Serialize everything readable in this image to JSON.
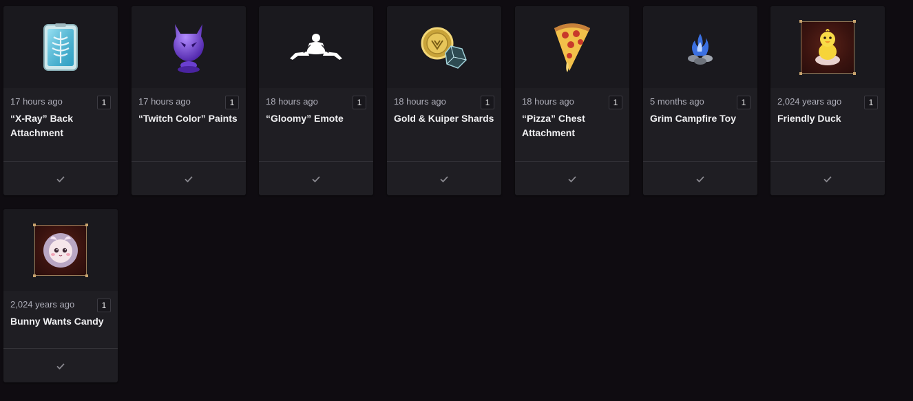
{
  "items": [
    {
      "time": "17 hours ago",
      "qty": "1",
      "name": "“X-Ray” Back Attachment",
      "icon": "xray-back-attachment-icon"
    },
    {
      "time": "17 hours ago",
      "qty": "1",
      "name": "“Twitch Color” Paints",
      "icon": "purple-paint-helmet-icon"
    },
    {
      "time": "18 hours ago",
      "qty": "1",
      "name": "“Gloomy” Emote",
      "icon": "gloomy-emote-icon"
    },
    {
      "time": "18 hours ago",
      "qty": "1",
      "name": "Gold & Kuiper Shards",
      "icon": "gold-coin-shard-icon"
    },
    {
      "time": "18 hours ago",
      "qty": "1",
      "name": "“Pizza” Chest Attachment",
      "icon": "pizza-slice-icon"
    },
    {
      "time": "5 months ago",
      "qty": "1",
      "name": "Grim Campfire Toy",
      "icon": "campfire-icon"
    },
    {
      "time": "2,024 years ago",
      "qty": "1",
      "name": "Friendly Duck",
      "icon": "duck-icon"
    },
    {
      "time": "2,024 years ago",
      "qty": "1",
      "name": "Bunny Wants Candy",
      "icon": "bunny-icon"
    }
  ],
  "colors": {
    "background": "#0f0c11",
    "card": "#1f1e23",
    "text_primary": "#efeff1",
    "text_secondary": "#adadb8"
  }
}
